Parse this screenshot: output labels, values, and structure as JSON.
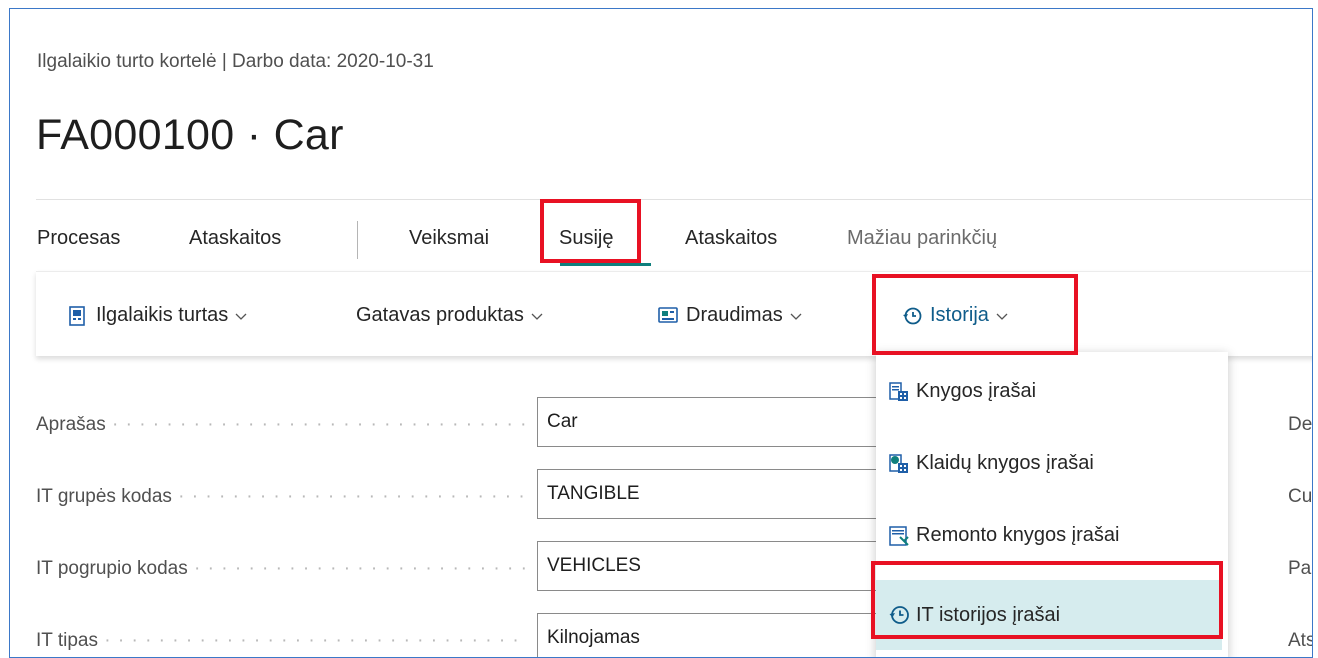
{
  "header": {
    "breadcrumb": "Ilgalaikio turto kortelė | Darbo data: 2020-10-31",
    "title": "FA000100 · Car"
  },
  "tabs": [
    {
      "label": "Procesas"
    },
    {
      "label": "Ataskaitos"
    },
    {
      "label": "Veiksmai"
    },
    {
      "label": "Susiję",
      "active": true
    },
    {
      "label": "Ataskaitos"
    },
    {
      "label": "Mažiau parinkčių"
    }
  ],
  "actions": [
    {
      "label": "Ilgalaikis turtas",
      "icon": "fixed-asset-icon"
    },
    {
      "label": "Gatavas produktas"
    },
    {
      "label": "Draudimas",
      "icon": "insurance-icon"
    },
    {
      "label": "Istorija",
      "icon": "history-icon",
      "open": true
    }
  ],
  "fields": [
    {
      "label": "Aprašas",
      "value": "Car"
    },
    {
      "label": "IT grupės kodas",
      "value": "TANGIBLE"
    },
    {
      "label": "IT pogrupio kodas",
      "value": "VEHICLES"
    },
    {
      "label": "IT tipas",
      "value": "Kilnojamas"
    }
  ],
  "right_column_fragments": [
    "De",
    "Cu",
    "Pa",
    "Ats"
  ],
  "dropdown": {
    "items": [
      {
        "label": "Knygos įrašai",
        "icon": "ledger-entries-icon"
      },
      {
        "label": "Klaidų knygos įrašai",
        "icon": "error-ledger-icon"
      },
      {
        "label": "Remonto knygos įrašai",
        "icon": "maintenance-ledger-icon"
      },
      {
        "label": "IT istorijos įrašai",
        "icon": "history-icon",
        "highlighted": true
      }
    ]
  },
  "colors": {
    "accent": "#0f7f7d",
    "highlight_border": "#e81123",
    "frame_border": "#3b78c8",
    "menu_active_bg": "#d6ecee"
  }
}
